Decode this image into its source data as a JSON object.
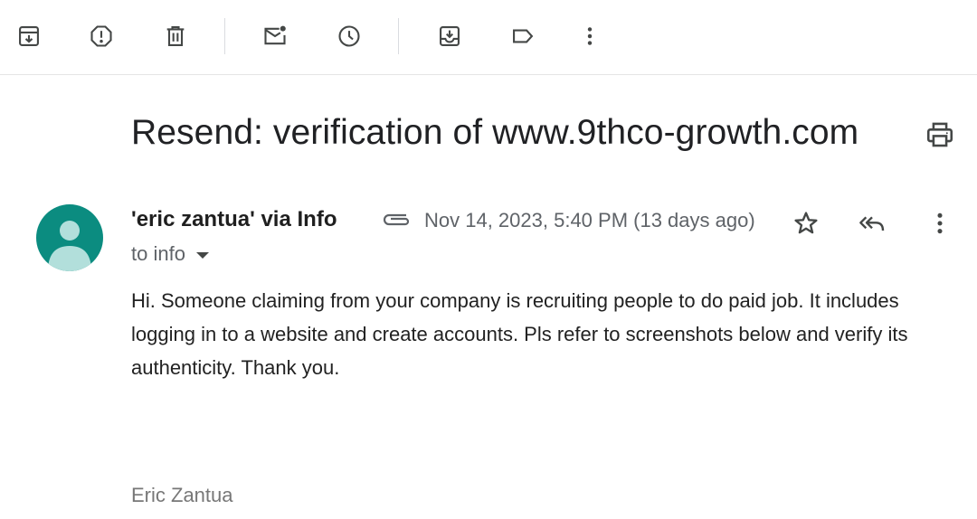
{
  "toolbar": {
    "buttons": [
      {
        "name": "archive-icon"
      },
      {
        "name": "report-spam-icon"
      },
      {
        "name": "delete-icon"
      },
      {
        "name": "mark-unread-icon"
      },
      {
        "name": "snooze-icon"
      },
      {
        "name": "move-to-icon"
      },
      {
        "name": "label-icon"
      },
      {
        "name": "more-vert-icon"
      }
    ]
  },
  "message": {
    "subject": "Resend: verification of www.9thco-growth.com",
    "sender": "'eric zantua' via Info",
    "date": "Nov 14, 2023, 5:40 PM (13 days ago)",
    "to": "to info",
    "body": "Hi. Someone claiming from your company is recruiting people to do paid job. It includes logging in to a website and create accounts. Pls refer to screenshots below and verify its authenticity. Thank you.",
    "signature": "Eric Zantua"
  },
  "colors": {
    "avatar_bg": "#0b8c80",
    "avatar_fg": "#b2dfdb",
    "icon": "#444746",
    "secondary_text": "#5f6368"
  }
}
